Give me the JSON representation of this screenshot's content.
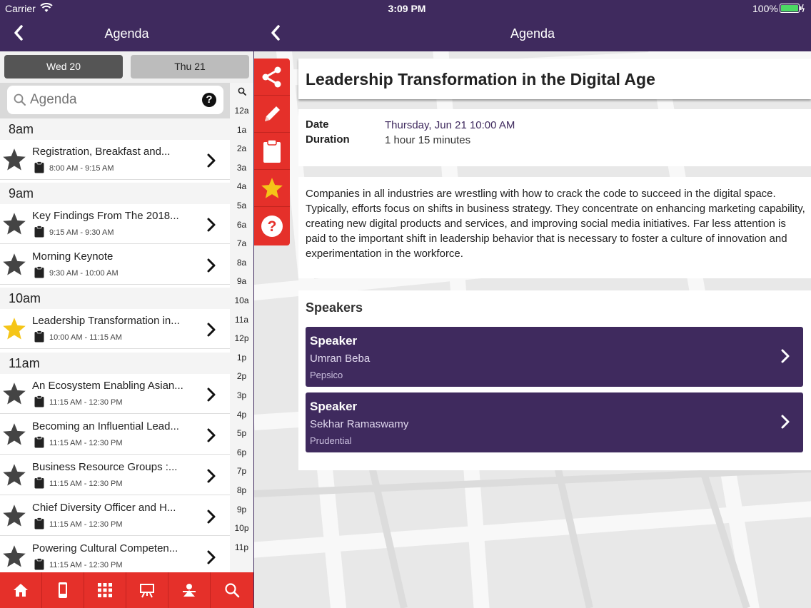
{
  "status_bar": {
    "carrier": "Carrier",
    "time": "3:09 PM",
    "battery": "100%"
  },
  "left": {
    "header_title": "Agenda",
    "days": [
      {
        "label": "Wed 20",
        "selected": true
      },
      {
        "label": "Thu 21",
        "selected": false
      }
    ],
    "search_placeholder": "Agenda",
    "help_label": "?",
    "hours": [
      "8am",
      "9am",
      "10am",
      "11am"
    ],
    "sessions": [
      {
        "title": "Registration, Breakfast and...",
        "time": "8:00 AM - 9:15 AM",
        "starred": false
      },
      {
        "title": "Key Findings From The 2018...",
        "time": "9:15 AM - 9:30 AM",
        "starred": false
      },
      {
        "title": "Morning Keynote",
        "time": "9:30 AM - 10:00 AM",
        "starred": false
      },
      {
        "title": "Leadership Transformation in...",
        "time": "10:00 AM - 11:15 AM",
        "starred": true
      },
      {
        "title": "An Ecosystem Enabling Asian...",
        "time": "11:15 AM - 12:30 PM",
        "starred": false
      },
      {
        "title": "Becoming an Influential Lead...",
        "time": "11:15 AM - 12:30 PM",
        "starred": false
      },
      {
        "title": "Business Resource Groups :...",
        "time": "11:15 AM - 12:30 PM",
        "starred": false
      },
      {
        "title": "Chief Diversity Officer and H...",
        "time": "11:15 AM - 12:30 PM",
        "starred": false
      },
      {
        "title": "Powering Cultural Competen...",
        "time": "11:15 AM - 12:30 PM",
        "starred": false
      }
    ],
    "index": [
      "12a",
      "1a",
      "2a",
      "3a",
      "4a",
      "5a",
      "6a",
      "7a",
      "8a",
      "9a",
      "10a",
      "11a",
      "12p",
      "1p",
      "2p",
      "3p",
      "4p",
      "5p",
      "6p",
      "7p",
      "8p",
      "9p",
      "10p",
      "11p"
    ],
    "tabbar": [
      "home-icon",
      "mobile-icon",
      "grid-icon",
      "presentation-icon",
      "person-icon",
      "search-icon"
    ]
  },
  "right": {
    "header_title": "Agenda",
    "actions": [
      "share-icon",
      "pencil-icon",
      "clipboard-icon",
      "star-icon",
      "help-icon"
    ],
    "session_title": "Leadership Transformation in the Digital Age",
    "date_label": "Date",
    "date_value": "Thursday, Jun 21 10:00 AM",
    "duration_label": "Duration",
    "duration_value": "1 hour 15 minutes",
    "description": "Companies in all industries are wrestling with how to crack the code to succeed in the digital space. Typically, efforts focus on shifts in business strategy. They concentrate on enhancing marketing capability, creating new digital products and services, and improving social media initiatives. Far less attention is paid to the important shift in leadership behavior that is necessary to foster a culture of innovation and experimentation in the workforce.",
    "speakers_heading": "Speakers",
    "speakers": [
      {
        "role": "Speaker",
        "name": "Umran Beba",
        "org": "Pepsico"
      },
      {
        "role": "Speaker",
        "name": "Sekhar Ramaswamy",
        "org": "Prudential"
      }
    ]
  },
  "colors": {
    "header": "#3f2a5e",
    "accent": "#e5302a",
    "star_active": "#f5c518",
    "star_inactive": "#444444",
    "link": "#3f2a5e"
  }
}
